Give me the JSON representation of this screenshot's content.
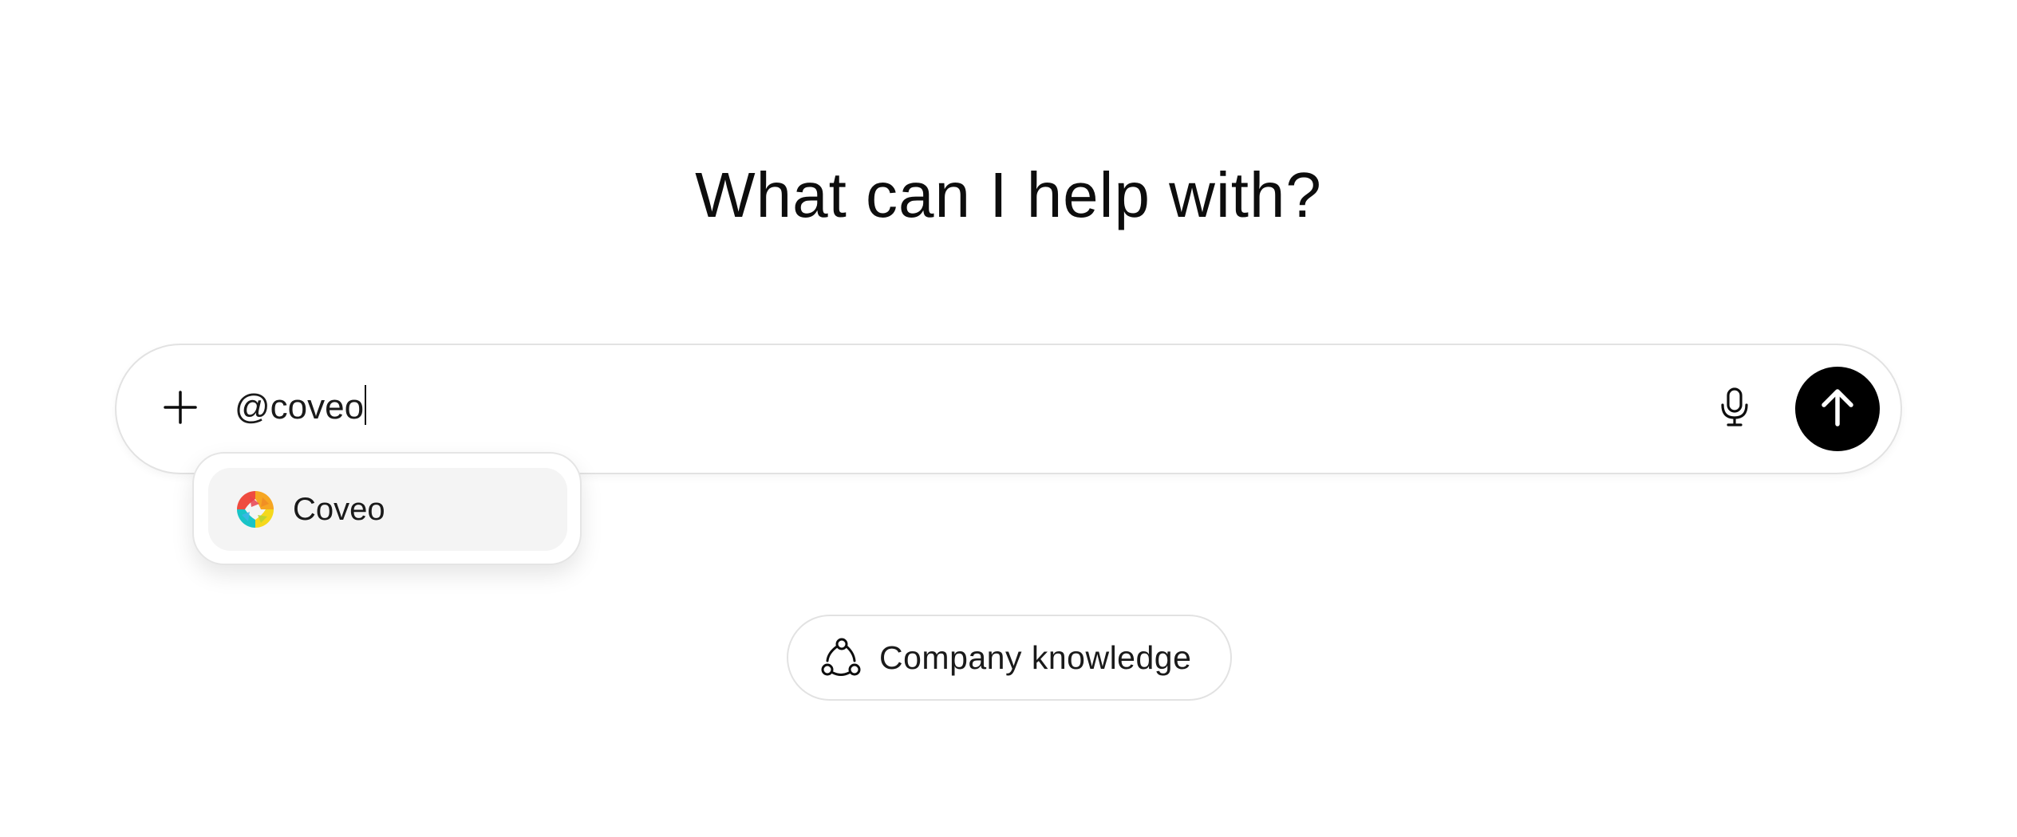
{
  "main": {
    "heading": "What can I help with?"
  },
  "composer": {
    "input_value": "@coveo",
    "icons": {
      "add": "plus-icon",
      "voice": "microphone-icon",
      "send": "arrow-up-icon"
    }
  },
  "mention_menu": {
    "items": [
      {
        "label": "Coveo",
        "icon": "coveo-logo"
      }
    ]
  },
  "suggestions": {
    "chip_label": "Company knowledge",
    "chip_icon": "connectors-icon"
  }
}
